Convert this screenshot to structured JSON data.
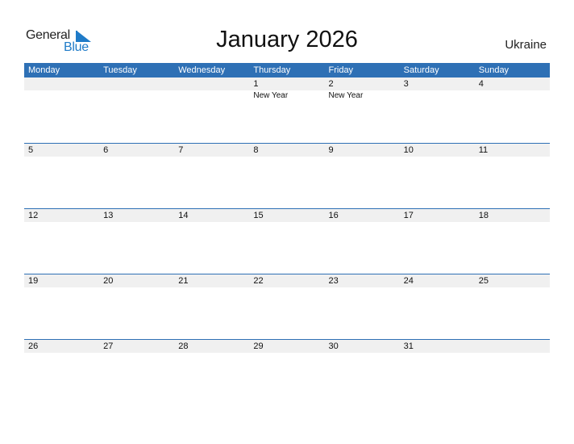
{
  "logo": {
    "part1": "General",
    "part2": "Blue"
  },
  "title": "January 2026",
  "country": "Ukraine",
  "colors": {
    "header": "#2e70b5",
    "accent": "#1f7bc8",
    "strip": "#f0f0f0"
  },
  "weekdays": [
    "Monday",
    "Tuesday",
    "Wednesday",
    "Thursday",
    "Friday",
    "Saturday",
    "Sunday"
  ],
  "weeks": [
    [
      {
        "day": "",
        "holiday": ""
      },
      {
        "day": "",
        "holiday": ""
      },
      {
        "day": "",
        "holiday": ""
      },
      {
        "day": "1",
        "holiday": "New Year"
      },
      {
        "day": "2",
        "holiday": "New Year"
      },
      {
        "day": "3",
        "holiday": ""
      },
      {
        "day": "4",
        "holiday": ""
      }
    ],
    [
      {
        "day": "5",
        "holiday": ""
      },
      {
        "day": "6",
        "holiday": ""
      },
      {
        "day": "7",
        "holiday": ""
      },
      {
        "day": "8",
        "holiday": ""
      },
      {
        "day": "9",
        "holiday": ""
      },
      {
        "day": "10",
        "holiday": ""
      },
      {
        "day": "11",
        "holiday": ""
      }
    ],
    [
      {
        "day": "12",
        "holiday": ""
      },
      {
        "day": "13",
        "holiday": ""
      },
      {
        "day": "14",
        "holiday": ""
      },
      {
        "day": "15",
        "holiday": ""
      },
      {
        "day": "16",
        "holiday": ""
      },
      {
        "day": "17",
        "holiday": ""
      },
      {
        "day": "18",
        "holiday": ""
      }
    ],
    [
      {
        "day": "19",
        "holiday": ""
      },
      {
        "day": "20",
        "holiday": ""
      },
      {
        "day": "21",
        "holiday": ""
      },
      {
        "day": "22",
        "holiday": ""
      },
      {
        "day": "23",
        "holiday": ""
      },
      {
        "day": "24",
        "holiday": ""
      },
      {
        "day": "25",
        "holiday": ""
      }
    ],
    [
      {
        "day": "26",
        "holiday": ""
      },
      {
        "day": "27",
        "holiday": ""
      },
      {
        "day": "28",
        "holiday": ""
      },
      {
        "day": "29",
        "holiday": ""
      },
      {
        "day": "30",
        "holiday": ""
      },
      {
        "day": "31",
        "holiday": ""
      },
      {
        "day": "",
        "holiday": ""
      }
    ]
  ]
}
